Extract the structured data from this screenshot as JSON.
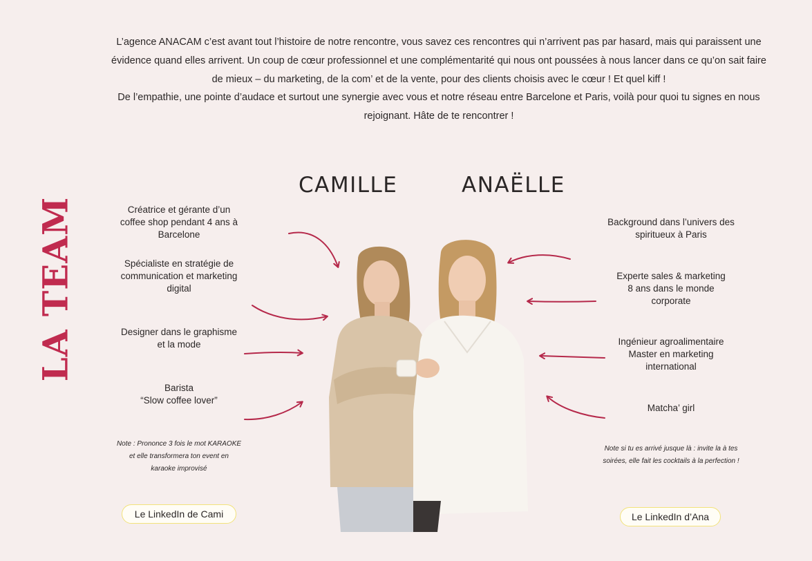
{
  "intro": {
    "p1": "L’agence ANACAM c’est avant tout l’histoire de notre rencontre, vous savez ces rencontres qui n’arrivent pas par hasard, mais qui paraissent une évidence quand elles arrivent. Un coup de cœur professionnel et une complémentarité qui nous ont poussées à nous lancer dans ce qu’on sait faire de mieux – du marketing, de la com’ et de la vente, pour des clients choisis avec le cœur ! Et quel kiff !",
    "p2": "De l’empathie, une pointe d’audace et surtout une synergie avec vous et notre réseau entre Barcelone et Paris, voilà pour quoi tu signes en nous rejoignant. Hâte de te rencontrer !"
  },
  "section_title": "LA TEAM",
  "camille": {
    "name": "CAMILLE",
    "traits": [
      "Créatrice et gérante d’un\ncoffee shop pendant 4 ans à\nBarcelone",
      "Spécialiste en stratégie de\ncommunication et marketing\ndigital",
      "Designer dans le graphisme\net la mode",
      "Barista\n“Slow coffee lover”"
    ],
    "note": "Note : Prononce 3 fois le mot KARAOKE et elle transformera ton event en karaoke improvisé",
    "linkedin": "Le LinkedIn de Cami"
  },
  "anaelle": {
    "name": "ANAËLLE",
    "traits": [
      "Background dans l’univers des\nspiritueux à Paris",
      "Experte sales & marketing\n8 ans dans le monde\ncorporate",
      "Ingénieur agroalimentaire\nMaster en marketing\ninternational",
      "Matcha’ girl"
    ],
    "note": "Note si tu es arrivé jusque là : invite la à tes soirées, elle fait les cocktails à la perfection !",
    "linkedin": "Le LinkedIn d’Ana"
  },
  "colors": {
    "background": "#f6eeed",
    "accent": "#c02b4f",
    "text": "#2a2626",
    "pill_border": "#f2e27a"
  },
  "icons": {
    "arrows": "curved-arrow-icon",
    "photo": "team-photo"
  }
}
